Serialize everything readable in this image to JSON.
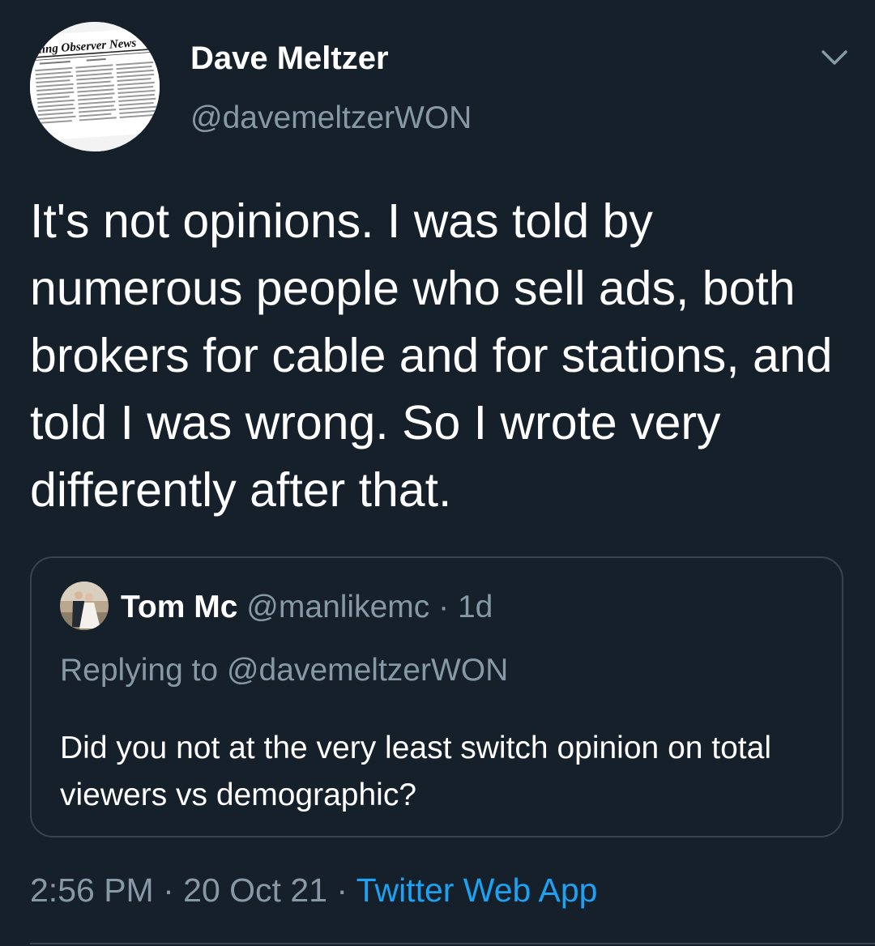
{
  "tweet": {
    "author": {
      "display_name": "Dave Meltzer",
      "handle": "@davemeltzerWON",
      "avatar_masthead": "ling Observer News"
    },
    "text": "It's not opinions.  I was told by numerous people who sell ads, both brokers for cable and for stations, and told I was wrong.  So I wrote very differently after that.",
    "menu_icon": "chevron-down-icon",
    "quoted": {
      "name": "Tom Mc",
      "handle": "@manlikemc",
      "separator": "·",
      "age": "1d",
      "replying_prefix": "Replying to",
      "replying_to": "@davemeltzerWON",
      "text": "Did you not at the very least switch opinion on total viewers vs demographic?"
    },
    "footer": {
      "time": "2:56 PM",
      "separator": "·",
      "date": "20 Oct 21",
      "source": "Twitter Web App"
    }
  },
  "colors": {
    "background": "#15202b",
    "primary_text": "#ffffff",
    "secondary_text": "#8899a6",
    "accent": "#1da1f2",
    "border": "#38444d"
  }
}
